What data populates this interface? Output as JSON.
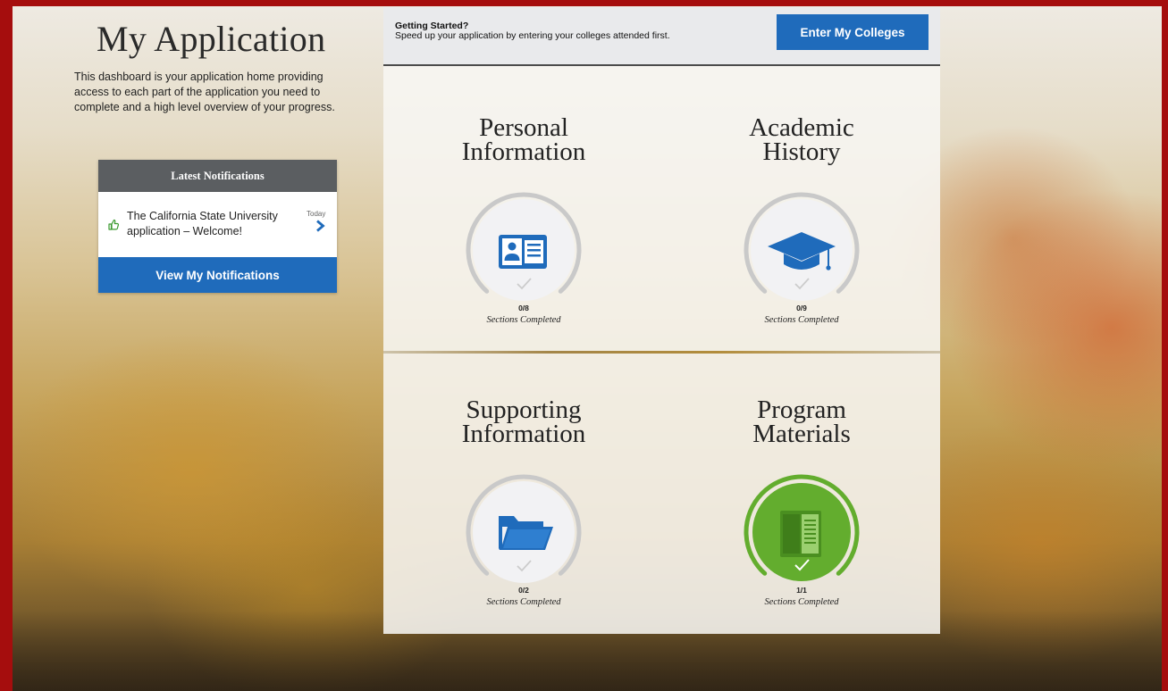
{
  "page": {
    "title": "My Application",
    "intro": "This dashboard is your application home providing access to each part of the application you need to complete and a high level overview of your progress."
  },
  "notifications": {
    "header": "Latest Notifications",
    "items": [
      {
        "text": "The California State University application – Welcome!",
        "date": "Today",
        "icon": "thumbs-up-icon"
      }
    ],
    "button_label": "View My Notifications"
  },
  "getting_started": {
    "heading": "Getting Started?",
    "text": "Speed up your application by entering your colleges attended first.",
    "button_label": "Enter My Colleges"
  },
  "sections": [
    {
      "title_line1": "Personal",
      "title_line2": "Information",
      "completed": 0,
      "total": 8,
      "progress_text": "0/8",
      "progress_label": "Sections Completed",
      "icon": "id-card-icon",
      "status": "incomplete"
    },
    {
      "title_line1": "Academic",
      "title_line2": "History",
      "completed": 0,
      "total": 9,
      "progress_text": "0/9",
      "progress_label": "Sections Completed",
      "icon": "graduation-cap-icon",
      "status": "incomplete"
    },
    {
      "title_line1": "Supporting",
      "title_line2": "Information",
      "completed": 0,
      "total": 2,
      "progress_text": "0/2",
      "progress_label": "Sections Completed",
      "icon": "folder-icon",
      "status": "incomplete"
    },
    {
      "title_line1": "Program",
      "title_line2": "Materials",
      "completed": 1,
      "total": 1,
      "progress_text": "1/1",
      "progress_label": "Sections Completed",
      "icon": "book-icon",
      "status": "complete"
    }
  ],
  "colors": {
    "brand_blue": "#1f6bbb",
    "complete_green": "#63ad2e",
    "frame_red": "#a50d0d",
    "ring_gray": "#c7c7c7"
  }
}
